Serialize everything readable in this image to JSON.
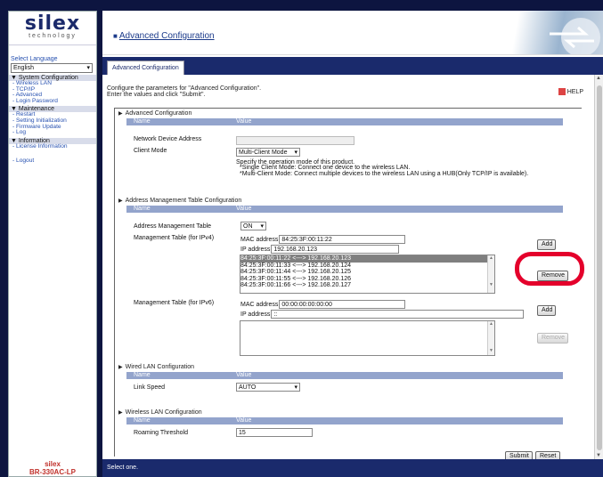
{
  "sidebar": {
    "logo_text": "silex",
    "logo_sub": "technology",
    "lang_label": "Select Language",
    "lang_value": "English",
    "sections": [
      {
        "title": "▼ System Configuration",
        "items": [
          "- Wireless LAN",
          "- TCP/IP",
          "- Advanced",
          "- Login Password"
        ]
      },
      {
        "title": "▼ Maintenance",
        "items": [
          "- Restart",
          "- Setting Initialization",
          "- Firmware Update",
          "- Log"
        ]
      },
      {
        "title": "▼ Information",
        "items": [
          "- License Information"
        ]
      }
    ],
    "logout": "- Logout",
    "brand": "silex",
    "model": "BR-330AC-LP"
  },
  "header": {
    "title": "Advanced Configuration",
    "tab": "Advanced Configuration"
  },
  "intro": {
    "line1": "Configure the parameters for \"Advanced Configuration\".",
    "line2": "Enter the values and click \"Submit\".",
    "help": "HELP"
  },
  "advanced": {
    "title": "Advanced Configuration",
    "col_name": "Name",
    "col_value": "Value",
    "nda_label": "Network Device Address",
    "nda_value": "",
    "mode_label": "Client Mode",
    "mode_value": "Multi-Client Mode",
    "desc1": "Specify the operation mode of this product.",
    "desc2": "*Single Client Mode: Connect one device to the wireless LAN.",
    "desc3": "*Multi-Client Mode: Connect multiple devices to the wireless LAN using a HUB(Only TCP/IP is available)."
  },
  "amt": {
    "title": "Address Management Table Configuration",
    "col_name": "Name",
    "col_value": "Value",
    "table_label": "Address Management Table",
    "table_value": "ON",
    "ipv4_label": "Management Table (for IPv4)",
    "mac_label": "MAC address",
    "mac_value": "84:25:3F:00:11:22",
    "ip_label": "IP address",
    "ip_value": "192.168.20.123",
    "add": "Add",
    "remove": "Remove",
    "entries": [
      "84:25:3F:00:11:22 <---> 192.168.20.123",
      "84:25:3F:00:11:33 <---> 192.168.20.124",
      "84:25:3F:00:11:44 <---> 192.168.20.125",
      "84:25:3F:00:11:55 <---> 192.168.20.126",
      "84:25:3F:00:11:66 <---> 192.168.20.127"
    ],
    "ipv6_label": "Management Table (for IPv6)",
    "mac6_value": "00:00:00:00:00:00",
    "ip6_value": "::"
  },
  "wired": {
    "title": "Wired LAN Configuration",
    "col_name": "Name",
    "col_value": "Value",
    "speed_label": "Link Speed",
    "speed_value": "AUTO"
  },
  "wireless": {
    "title": "Wireless LAN Configuration",
    "col_name": "Name",
    "col_value": "Value",
    "roam_label": "Roaming Threshold",
    "roam_value": "15"
  },
  "actions": {
    "submit": "Submit",
    "reset": "Reset"
  },
  "status": "Select one."
}
